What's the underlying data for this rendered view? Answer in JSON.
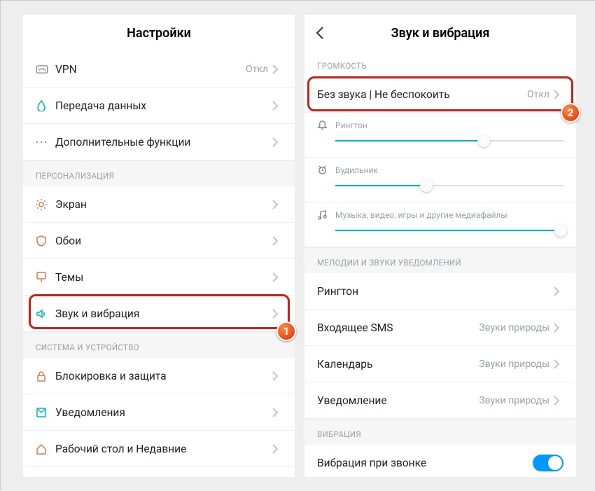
{
  "left": {
    "title": "Настройки",
    "items": {
      "vpn": {
        "label": "VPN",
        "value": "Откл"
      },
      "data": {
        "label": "Передача данных"
      },
      "more": {
        "label": "Дополнительные функции"
      }
    },
    "sect_personal": "ПЕРСОНАЛИЗАЦИЯ",
    "personal": {
      "screen": {
        "label": "Экран"
      },
      "wallpaper": {
        "label": "Обои"
      },
      "themes": {
        "label": "Темы"
      },
      "sound": {
        "label": "Звук и вибрация"
      }
    },
    "sect_system": "СИСТЕМА И УСТРОЙСТВО",
    "system": {
      "lock": {
        "label": "Блокировка и защита"
      },
      "notif": {
        "label": "Уведомления"
      },
      "desk": {
        "label": "Рабочий стол и Недавние"
      }
    }
  },
  "right": {
    "title": "Звук и вибрация",
    "sect_vol": "ГРОМКОСТЬ",
    "dnd": {
      "label": "Без звука | Не беспокоить",
      "value": "Откл"
    },
    "sliders": {
      "ring": {
        "label": "Рингтон",
        "pct": 65
      },
      "alarm": {
        "label": "Будильник",
        "pct": 40
      },
      "media": {
        "label": "Музыка, видео, игры и другие медиафайлы",
        "pct": 100
      }
    },
    "sect_mel": "МЕЛОДИИ И ЗВУКИ УВЕДОМЛЕНИЙ",
    "mel": {
      "ring": {
        "label": "Рингтон",
        "value": ""
      },
      "sms": {
        "label": "Входящее SMS",
        "value": "Звуки природы"
      },
      "cal": {
        "label": "Календарь",
        "value": "Звуки природы"
      },
      "notif": {
        "label": "Уведомление",
        "value": "Звуки природы"
      }
    },
    "sect_vib": "ВИБРАЦИЯ",
    "vib": {
      "label": "Вибрация при звонке"
    }
  },
  "callouts": {
    "one": "1",
    "two": "2"
  }
}
